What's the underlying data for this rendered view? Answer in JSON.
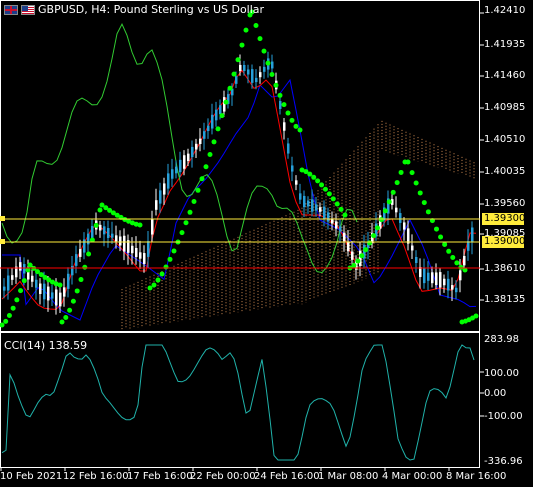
{
  "title": {
    "symbol_text": "GBPUSD, H4: Pound Sterling vs US Dollar",
    "icons": [
      "gb-flag-icon",
      "us-flag-icon"
    ]
  },
  "price_axis": [
    "1.42410",
    "1.41935",
    "1.41460",
    "1.40985",
    "1.40510",
    "1.40035",
    "1.39560",
    "1.39085",
    "1.38610",
    "1.38135"
  ],
  "price_tags": {
    "ask": "1.39300",
    "bid": "1.39000"
  },
  "indicator": {
    "label": "CCI(14) 138.59",
    "axis": [
      "283.98",
      "100.00",
      "0.00",
      "-100.00",
      "-336.96"
    ]
  },
  "time_axis": [
    "10 Feb 2021",
    "12 Feb 16:00",
    "17 Feb 16:00",
    "22 Feb 00:00",
    "24 Feb 16:00",
    "1 Mar 08:00",
    "4 Mar 00:00",
    "8 Mar 16:00"
  ],
  "colors": {
    "bull": "#ffffff",
    "bear": "#26a0da",
    "psar": "#00ff00",
    "kijun": "#0000ff",
    "tenkan": "#ff0000",
    "chikou": "#32cd32",
    "kumo_up": "#f4a460",
    "kumo_down": "#f4a460",
    "cci": "#20b2aa",
    "tag_ask": "#ffeb3b",
    "tag_bid": "#ffffff",
    "grid": "#ffffff"
  }
}
